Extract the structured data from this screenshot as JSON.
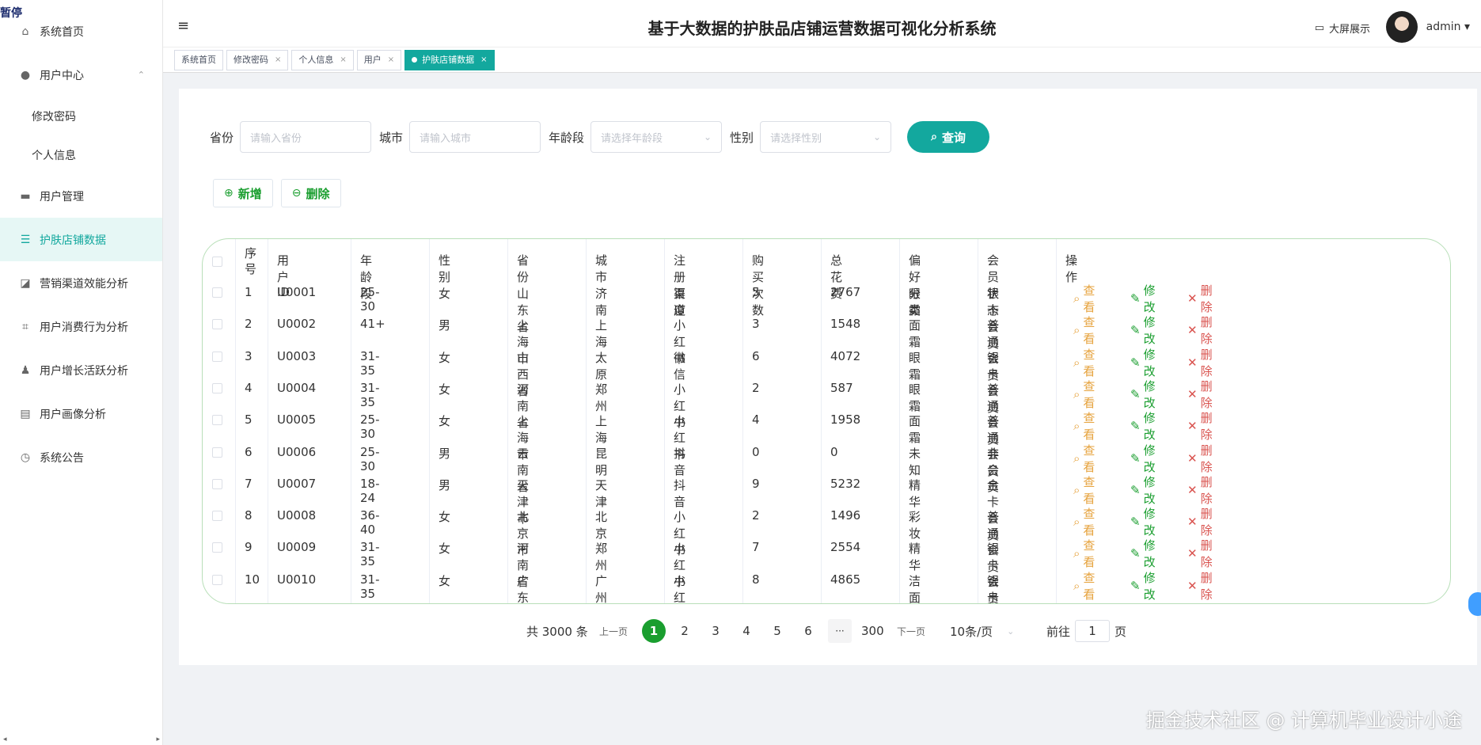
{
  "sidebar": {
    "badge": "暂停",
    "items": [
      {
        "label": "系统首页",
        "icon": "home-icon",
        "glyph": "⌂"
      },
      {
        "label": "用户中心",
        "icon": "user-icon",
        "glyph": "●",
        "caret": "⌃"
      },
      {
        "label": "修改密码"
      },
      {
        "label": "个人信息"
      },
      {
        "label": "用户管理",
        "icon": "user-manage-icon",
        "glyph": "▬"
      },
      {
        "label": "护肤店铺数据",
        "icon": "list-icon",
        "glyph": "☰"
      },
      {
        "label": "营销渠道效能分析",
        "icon": "chart-icon",
        "glyph": "◪"
      },
      {
        "label": "用户消费行为分析",
        "icon": "crop-icon",
        "glyph": "⌗"
      },
      {
        "label": "用户增长活跃分析",
        "icon": "person-icon",
        "glyph": "♟"
      },
      {
        "label": "用户画像分析",
        "icon": "message-icon",
        "glyph": "▤"
      },
      {
        "label": "系统公告",
        "icon": "clock-icon",
        "glyph": "◷"
      }
    ],
    "scroll_left": "◂",
    "scroll_right": "▸"
  },
  "header": {
    "menu_glyph": "≡",
    "title": "基于大数据的护肤品店铺运营数据可视化分析系统",
    "big_screen_label": "大屏展示",
    "big_screen_glyph": "▭",
    "username": "admin",
    "user_caret": "▾"
  },
  "tabs": [
    {
      "label": "系统首页"
    },
    {
      "label": "修改密码",
      "close": "×"
    },
    {
      "label": "个人信息",
      "close": "×"
    },
    {
      "label": "用户",
      "close": "×"
    },
    {
      "label": "护肤店铺数据",
      "close": "×"
    }
  ],
  "search": {
    "province_label": "省份",
    "province_placeholder": "请输入省份",
    "city_label": "城市",
    "city_placeholder": "请输入城市",
    "age_label": "年龄段",
    "age_placeholder": "请选择年龄段",
    "gender_label": "性别",
    "gender_placeholder": "请选择性别",
    "chevron": "⌄",
    "query_label": "查询",
    "query_glyph": "⌕"
  },
  "actions": {
    "add_label": "新增",
    "add_glyph": "⊕",
    "delete_label": "删除",
    "delete_glyph": "⊖"
  },
  "table": {
    "headers": [
      "序号",
      "用户ID",
      "年龄段",
      "性别",
      "省份",
      "城市",
      "注册渠道",
      "购买次数",
      "总花费",
      "偏好分类",
      "会员状态",
      "操作"
    ],
    "op_view": "查看",
    "op_edit": "修改",
    "op_delete": "删除",
    "op_view_glyph": "⌕",
    "op_edit_glyph": "✎",
    "op_delete_glyph": "✕",
    "rows": [
      [
        "1",
        "U0001",
        "25-30",
        "女",
        "山东省",
        "济南",
        "百度",
        "5",
        "2767",
        "眼霜",
        "银卡会员"
      ],
      [
        "2",
        "U0002",
        "41+",
        "男",
        "上海市",
        "上海",
        "小红书",
        "3",
        "1548",
        "面霜",
        "普通会员"
      ],
      [
        "3",
        "U0003",
        "31-35",
        "女",
        "山西省",
        "太原",
        "微信",
        "6",
        "4072",
        "眼霜",
        "银卡会员"
      ],
      [
        "4",
        "U0004",
        "31-35",
        "女",
        "河南省",
        "郑州",
        "小红书",
        "2",
        "587",
        "眼霜",
        "普通会员"
      ],
      [
        "5",
        "U0005",
        "25-30",
        "女",
        "上海市",
        "上海",
        "小红书",
        "4",
        "1958",
        "面霜",
        "普通会员"
      ],
      [
        "6",
        "U0006",
        "25-30",
        "男",
        "云南省",
        "昆明",
        "抖音",
        "0",
        "0",
        "未知",
        "非会员"
      ],
      [
        "7",
        "U0007",
        "18-24",
        "男",
        "天津市",
        "天津",
        "抖音",
        "9",
        "5232",
        "精华",
        "金卡会员"
      ],
      [
        "8",
        "U0008",
        "36-40",
        "女",
        "北京市",
        "北京",
        "小红书",
        "2",
        "1496",
        "彩妆",
        "普通会员"
      ],
      [
        "9",
        "U0009",
        "31-35",
        "女",
        "河南省",
        "郑州",
        "小红书",
        "7",
        "2554",
        "精华",
        "银卡会员"
      ],
      [
        "10",
        "U0010",
        "31-35",
        "女",
        "广东省",
        "广州",
        "小红书",
        "8",
        "4865",
        "洁面",
        "银卡会员"
      ]
    ]
  },
  "pagination": {
    "total": "共 3000 条",
    "prev": "上一页",
    "pages": [
      "1",
      "2",
      "3",
      "4",
      "5",
      "6"
    ],
    "ellipsis": "···",
    "last": "300",
    "next": "下一页",
    "page_size": "10条/页",
    "page_size_chevron": "⌄",
    "goto_label": "前往",
    "goto_value": "1",
    "goto_suffix": "页"
  },
  "watermark": "掘金技术社区 @ 计算机毕业设计小途",
  "colors": {
    "accent": "#13a89e",
    "success": "#1a9e2f",
    "warning": "#e6a23c",
    "danger": "#d9534f"
  }
}
